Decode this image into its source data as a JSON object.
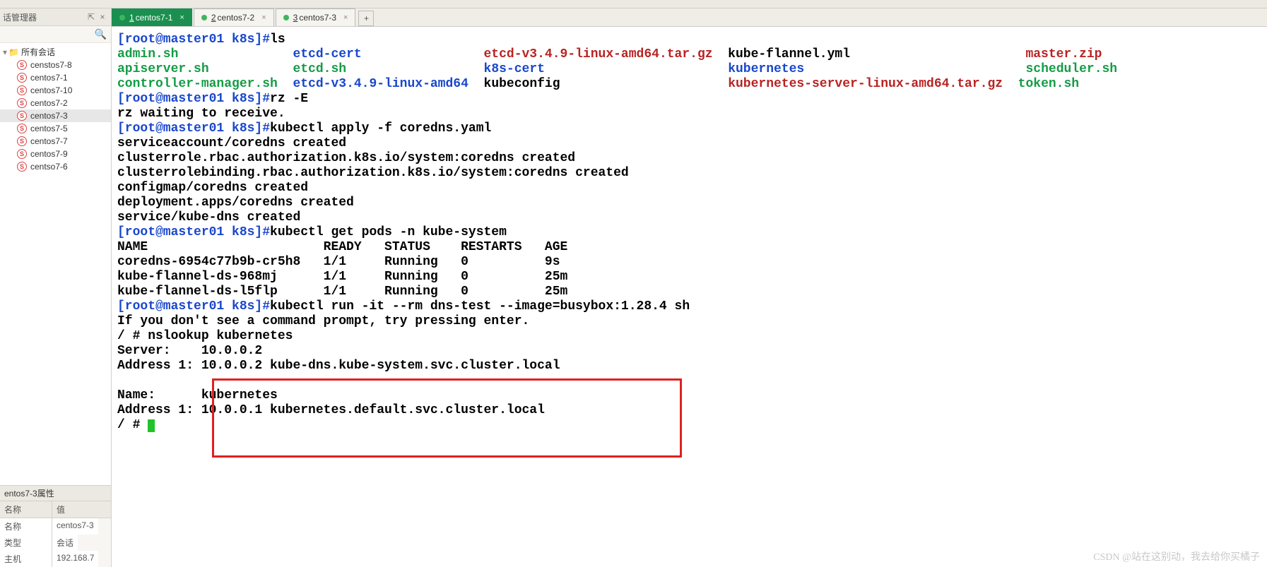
{
  "topbar_hint": "",
  "sidebar": {
    "title": "话管理器",
    "pin": "⇱",
    "close": "×",
    "root_label": "所有会话",
    "items": [
      {
        "label": "censtos7-8"
      },
      {
        "label": "centos7-1"
      },
      {
        "label": "centos7-10"
      },
      {
        "label": "centos7-2"
      },
      {
        "label": "centos7-3"
      },
      {
        "label": "centos7-5"
      },
      {
        "label": "centos7-7"
      },
      {
        "label": "centos7-9"
      },
      {
        "label": "centso7-6"
      }
    ],
    "props_title": "entos7-3属性",
    "props_headers": {
      "k": "名称",
      "v": "值"
    },
    "props_rows": [
      {
        "k": "名称",
        "v": "centos7-3"
      },
      {
        "k": "类型",
        "v": "会话"
      },
      {
        "k": "主机",
        "v": "192.168.7"
      }
    ]
  },
  "tabs": {
    "items": [
      {
        "num": "1",
        "label": "centos7-1",
        "active": true
      },
      {
        "num": "2",
        "label": "centos7-2",
        "active": false
      },
      {
        "num": "3",
        "label": "centos7-3",
        "active": false
      }
    ],
    "add": "+"
  },
  "terminal": {
    "prompt": "[root@master01 k8s]#",
    "cmd_ls": "ls",
    "ls_grid": {
      "c1": [
        "admin.sh",
        "apiserver.sh",
        "controller-manager.sh"
      ],
      "c2": [
        "etcd-cert",
        "etcd.sh",
        "etcd-v3.4.9-linux-amd64"
      ],
      "c3": [
        "etcd-v3.4.9-linux-amd64.tar.gz",
        "k8s-cert",
        "kubeconfig"
      ],
      "c4": [
        "kube-flannel.yml",
        "kubernetes",
        "kubernetes-server-linux-amd64.tar.gz"
      ],
      "c5": [
        "master.zip",
        "scheduler.sh",
        "token.sh"
      ]
    },
    "cmd_rz": "rz -E",
    "rz_wait": "rz waiting to receive.",
    "cmd_apply": "kubectl apply -f coredns.yaml",
    "apply_out": [
      "serviceaccount/coredns created",
      "clusterrole.rbac.authorization.k8s.io/system:coredns created",
      "clusterrolebinding.rbac.authorization.k8s.io/system:coredns created",
      "configmap/coredns created",
      "deployment.apps/coredns created",
      "service/kube-dns created"
    ],
    "cmd_getpods": "kubectl get pods -n kube-system",
    "pods_header": "NAME                       READY   STATUS    RESTARTS   AGE",
    "pods_rows": [
      "coredns-6954c77b9b-cr5h8   1/1     Running   0          9s",
      "kube-flannel-ds-968mj      1/1     Running   0          25m",
      "kube-flannel-ds-l5flp      1/1     Running   0          25m"
    ],
    "cmd_run": "kubectl run -it --rm dns-test --image=busybox:1.28.4 sh",
    "run_hint": "If you don't see a command prompt, try pressing enter.",
    "ns_prompt": "/ # ",
    "ns_cmd": "nslookup kubernetes",
    "ns_server": "Server:    10.0.0.2",
    "ns_addr1": "Address 1: 10.0.0.2 kube-dns.kube-system.svc.cluster.local",
    "ns_name": "Name:      kubernetes",
    "ns_addr2": "Address 1: 10.0.0.1 kubernetes.default.svc.cluster.local"
  },
  "watermark": "CSDN @站在这别动，我去给你买橘子"
}
